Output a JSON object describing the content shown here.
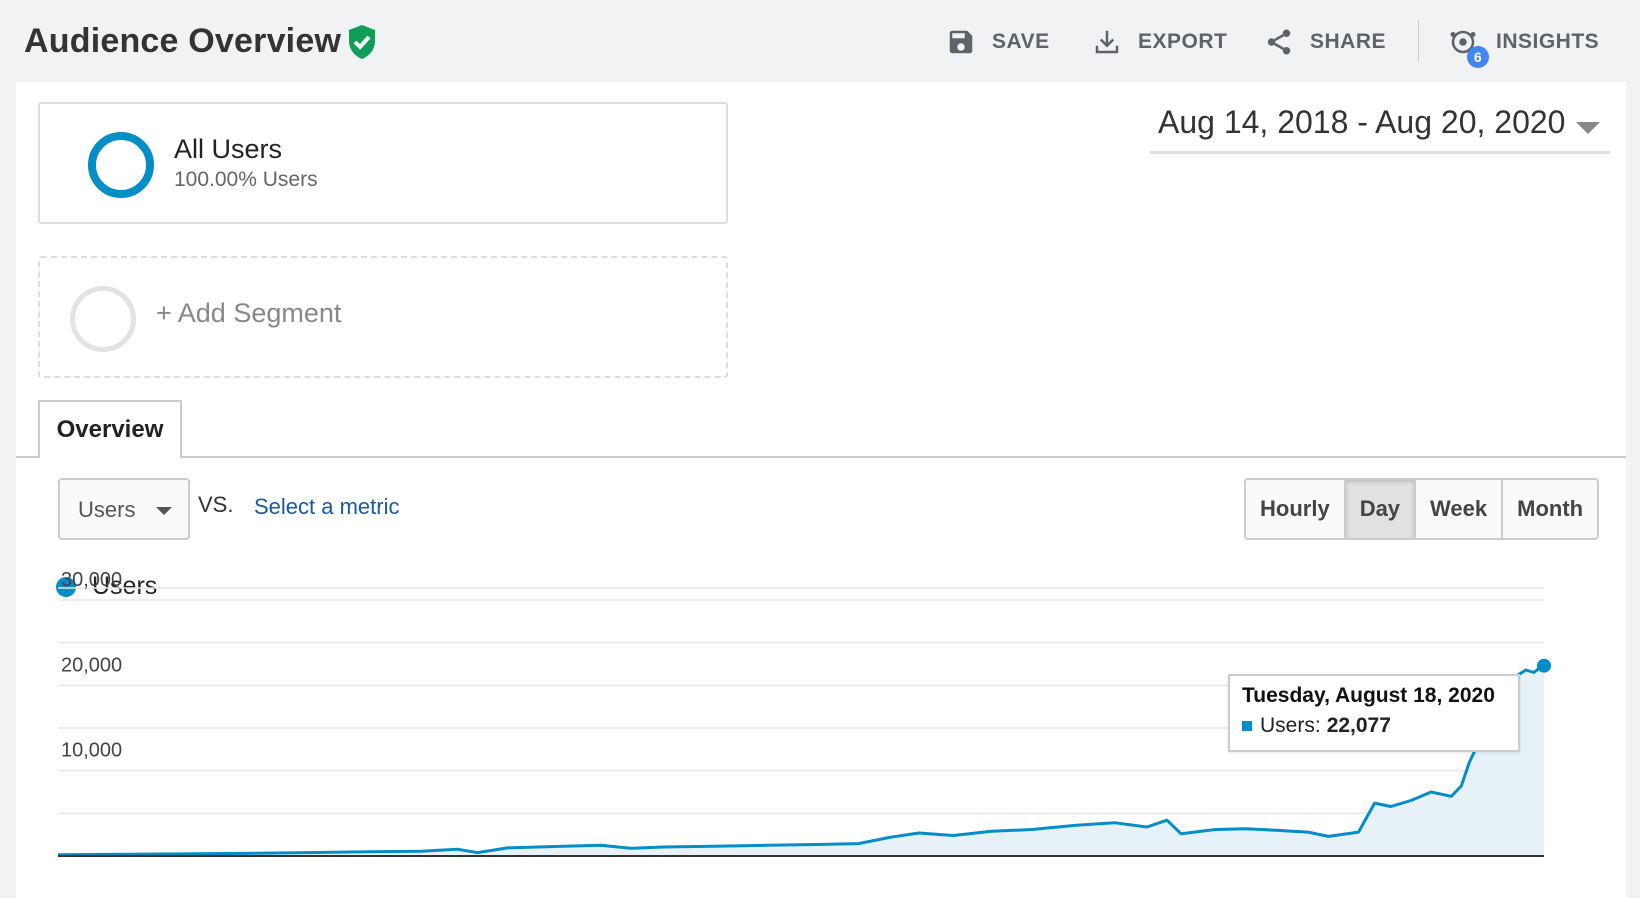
{
  "header": {
    "title": "Audience Overview",
    "actions": [
      {
        "label": "SAVE",
        "icon": "save-icon"
      },
      {
        "label": "EXPORT",
        "icon": "download-icon"
      },
      {
        "label": "SHARE",
        "icon": "share-icon"
      },
      {
        "label": "INSIGHTS",
        "icon": "insights-icon",
        "badge": "6"
      }
    ]
  },
  "segments": {
    "active": {
      "name": "All Users",
      "subtitle": "100.00% Users",
      "color": "#058dc7"
    },
    "add_label": "+ Add Segment"
  },
  "date_range": "Aug 14, 2018 - Aug 20, 2020",
  "tabs": [
    {
      "label": "Overview"
    }
  ],
  "metric": {
    "selected": "Users",
    "vs": "VS.",
    "select_link": "Select a metric"
  },
  "granularity": [
    {
      "label": "Hourly",
      "active": false
    },
    {
      "label": "Day",
      "active": true
    },
    {
      "label": "Week",
      "active": false
    },
    {
      "label": "Month",
      "active": false
    }
  ],
  "tooltip": {
    "date": "Tuesday, August 18, 2020",
    "label": "Users:",
    "value": "22,077"
  },
  "chart_data": {
    "type": "area",
    "series": [
      {
        "name": "Users",
        "color": "#058dc7"
      }
    ],
    "x_range": [
      "2018-08-14",
      "2020-08-20"
    ],
    "yticks": [
      {
        "value": 30000,
        "label": "30,000"
      },
      {
        "value": 20000,
        "label": "20,000"
      },
      {
        "value": 10000,
        "label": "10,000"
      }
    ],
    "ylim": [
      0,
      30000
    ],
    "points": [
      [
        "2018-08-14",
        150
      ],
      [
        "2018-09-15",
        200
      ],
      [
        "2018-10-15",
        250
      ],
      [
        "2018-11-15",
        300
      ],
      [
        "2018-12-15",
        400
      ],
      [
        "2019-01-15",
        500
      ],
      [
        "2019-02-10",
        550
      ],
      [
        "2019-02-28",
        800
      ],
      [
        "2019-03-10",
        400
      ],
      [
        "2019-03-25",
        950
      ],
      [
        "2019-04-15",
        1100
      ],
      [
        "2019-05-10",
        1250
      ],
      [
        "2019-05-25",
        900
      ],
      [
        "2019-06-10",
        1050
      ],
      [
        "2019-07-05",
        1150
      ],
      [
        "2019-08-01",
        1250
      ],
      [
        "2019-08-25",
        1350
      ],
      [
        "2019-09-15",
        1450
      ],
      [
        "2019-10-01",
        2200
      ],
      [
        "2019-10-15",
        2700
      ],
      [
        "2019-11-01",
        2400
      ],
      [
        "2019-11-20",
        2900
      ],
      [
        "2019-12-10",
        3100
      ],
      [
        "2020-01-01",
        3600
      ],
      [
        "2020-01-20",
        3900
      ],
      [
        "2020-02-05",
        3400
      ],
      [
        "2020-02-15",
        4200
      ],
      [
        "2020-02-22",
        2600
      ],
      [
        "2020-03-10",
        3100
      ],
      [
        "2020-03-25",
        3200
      ],
      [
        "2020-04-10",
        3000
      ],
      [
        "2020-04-25",
        2800
      ],
      [
        "2020-05-05",
        2300
      ],
      [
        "2020-05-20",
        2800
      ],
      [
        "2020-05-28",
        6200
      ],
      [
        "2020-06-05",
        5800
      ],
      [
        "2020-06-15",
        6500
      ],
      [
        "2020-06-25",
        7500
      ],
      [
        "2020-07-05",
        7000
      ],
      [
        "2020-07-10",
        8200
      ],
      [
        "2020-07-14",
        11000
      ],
      [
        "2020-07-18",
        13000
      ],
      [
        "2020-07-22",
        14500
      ],
      [
        "2020-07-26",
        16500
      ],
      [
        "2020-07-30",
        18000
      ],
      [
        "2020-08-03",
        20000
      ],
      [
        "2020-08-07",
        21200
      ],
      [
        "2020-08-11",
        21800
      ],
      [
        "2020-08-15",
        21500
      ],
      [
        "2020-08-18",
        22077
      ],
      [
        "2020-08-20",
        22300
      ]
    ]
  }
}
